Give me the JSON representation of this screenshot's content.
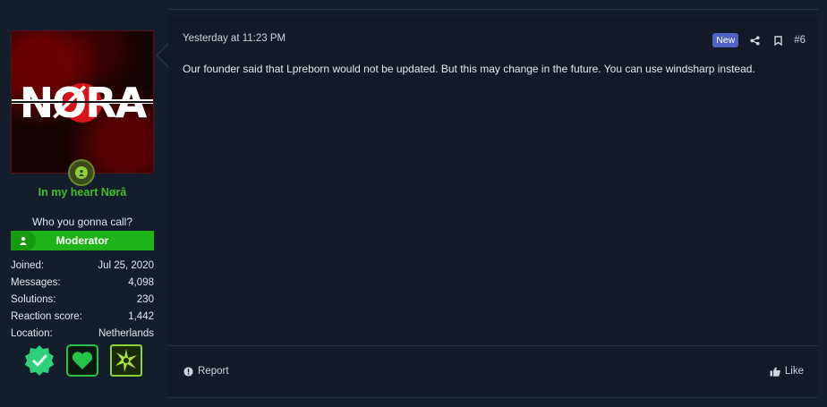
{
  "user": {
    "avatar_logo": "NØRA",
    "username": "In my heart Nørâ",
    "custom_title": "Who you gonna call?",
    "role_banner": "Moderator",
    "stats": [
      {
        "label": "Joined:",
        "value": "Jul 25, 2020"
      },
      {
        "label": "Messages:",
        "value": "4,098"
      },
      {
        "label": "Solutions:",
        "value": "230"
      },
      {
        "label": "Reaction score:",
        "value": "1,442"
      },
      {
        "label": "Location:",
        "value": "Netherlands"
      }
    ],
    "trophies": [
      "verified-badge-icon",
      "heart-icon",
      "sparkle-icon"
    ],
    "colors": {
      "username": "#3fbf2a",
      "banner": "#1fb31a",
      "online": "#8fd13a"
    }
  },
  "message": {
    "date": "Yesterday at 11:23 PM",
    "new_badge": "New",
    "post_number": "#6",
    "body": "Our founder said that Lpreborn would not be updated. But this may change in the future. You can use windsharp instead.",
    "report_label": "Report",
    "like_label": "Like",
    "colors": {
      "new_badge": "#4f62c8"
    }
  }
}
